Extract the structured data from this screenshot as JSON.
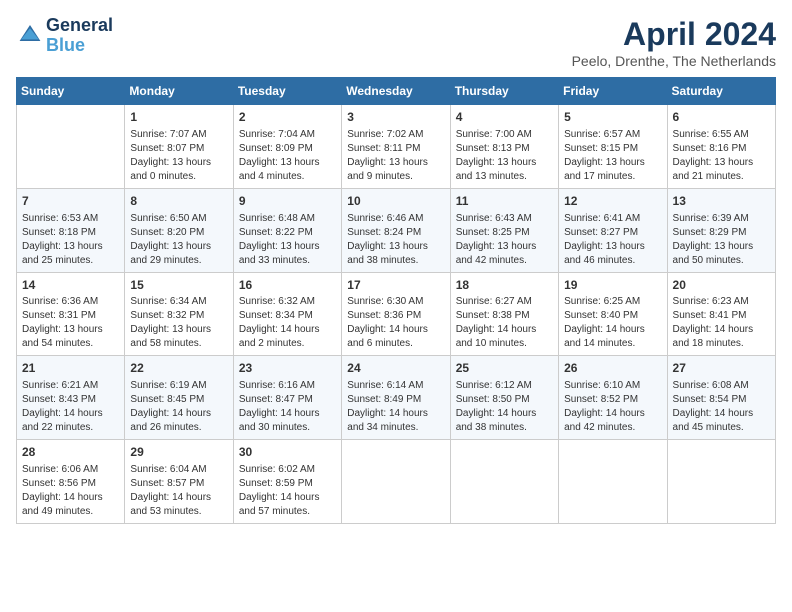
{
  "header": {
    "logo_line1": "General",
    "logo_line2": "Blue",
    "month_title": "April 2024",
    "location": "Peelo, Drenthe, The Netherlands"
  },
  "weekdays": [
    "Sunday",
    "Monday",
    "Tuesday",
    "Wednesday",
    "Thursday",
    "Friday",
    "Saturday"
  ],
  "weeks": [
    [
      {
        "day": "",
        "sunrise": "",
        "sunset": "",
        "daylight": ""
      },
      {
        "day": "1",
        "sunrise": "7:07 AM",
        "sunset": "8:07 PM",
        "daylight": "13 hours and 0 minutes."
      },
      {
        "day": "2",
        "sunrise": "7:04 AM",
        "sunset": "8:09 PM",
        "daylight": "13 hours and 4 minutes."
      },
      {
        "day": "3",
        "sunrise": "7:02 AM",
        "sunset": "8:11 PM",
        "daylight": "13 hours and 9 minutes."
      },
      {
        "day": "4",
        "sunrise": "7:00 AM",
        "sunset": "8:13 PM",
        "daylight": "13 hours and 13 minutes."
      },
      {
        "day": "5",
        "sunrise": "6:57 AM",
        "sunset": "8:15 PM",
        "daylight": "13 hours and 17 minutes."
      },
      {
        "day": "6",
        "sunrise": "6:55 AM",
        "sunset": "8:16 PM",
        "daylight": "13 hours and 21 minutes."
      }
    ],
    [
      {
        "day": "7",
        "sunrise": "6:53 AM",
        "sunset": "8:18 PM",
        "daylight": "13 hours and 25 minutes."
      },
      {
        "day": "8",
        "sunrise": "6:50 AM",
        "sunset": "8:20 PM",
        "daylight": "13 hours and 29 minutes."
      },
      {
        "day": "9",
        "sunrise": "6:48 AM",
        "sunset": "8:22 PM",
        "daylight": "13 hours and 33 minutes."
      },
      {
        "day": "10",
        "sunrise": "6:46 AM",
        "sunset": "8:24 PM",
        "daylight": "13 hours and 38 minutes."
      },
      {
        "day": "11",
        "sunrise": "6:43 AM",
        "sunset": "8:25 PM",
        "daylight": "13 hours and 42 minutes."
      },
      {
        "day": "12",
        "sunrise": "6:41 AM",
        "sunset": "8:27 PM",
        "daylight": "13 hours and 46 minutes."
      },
      {
        "day": "13",
        "sunrise": "6:39 AM",
        "sunset": "8:29 PM",
        "daylight": "13 hours and 50 minutes."
      }
    ],
    [
      {
        "day": "14",
        "sunrise": "6:36 AM",
        "sunset": "8:31 PM",
        "daylight": "13 hours and 54 minutes."
      },
      {
        "day": "15",
        "sunrise": "6:34 AM",
        "sunset": "8:32 PM",
        "daylight": "13 hours and 58 minutes."
      },
      {
        "day": "16",
        "sunrise": "6:32 AM",
        "sunset": "8:34 PM",
        "daylight": "14 hours and 2 minutes."
      },
      {
        "day": "17",
        "sunrise": "6:30 AM",
        "sunset": "8:36 PM",
        "daylight": "14 hours and 6 minutes."
      },
      {
        "day": "18",
        "sunrise": "6:27 AM",
        "sunset": "8:38 PM",
        "daylight": "14 hours and 10 minutes."
      },
      {
        "day": "19",
        "sunrise": "6:25 AM",
        "sunset": "8:40 PM",
        "daylight": "14 hours and 14 minutes."
      },
      {
        "day": "20",
        "sunrise": "6:23 AM",
        "sunset": "8:41 PM",
        "daylight": "14 hours and 18 minutes."
      }
    ],
    [
      {
        "day": "21",
        "sunrise": "6:21 AM",
        "sunset": "8:43 PM",
        "daylight": "14 hours and 22 minutes."
      },
      {
        "day": "22",
        "sunrise": "6:19 AM",
        "sunset": "8:45 PM",
        "daylight": "14 hours and 26 minutes."
      },
      {
        "day": "23",
        "sunrise": "6:16 AM",
        "sunset": "8:47 PM",
        "daylight": "14 hours and 30 minutes."
      },
      {
        "day": "24",
        "sunrise": "6:14 AM",
        "sunset": "8:49 PM",
        "daylight": "14 hours and 34 minutes."
      },
      {
        "day": "25",
        "sunrise": "6:12 AM",
        "sunset": "8:50 PM",
        "daylight": "14 hours and 38 minutes."
      },
      {
        "day": "26",
        "sunrise": "6:10 AM",
        "sunset": "8:52 PM",
        "daylight": "14 hours and 42 minutes."
      },
      {
        "day": "27",
        "sunrise": "6:08 AM",
        "sunset": "8:54 PM",
        "daylight": "14 hours and 45 minutes."
      }
    ],
    [
      {
        "day": "28",
        "sunrise": "6:06 AM",
        "sunset": "8:56 PM",
        "daylight": "14 hours and 49 minutes."
      },
      {
        "day": "29",
        "sunrise": "6:04 AM",
        "sunset": "8:57 PM",
        "daylight": "14 hours and 53 minutes."
      },
      {
        "day": "30",
        "sunrise": "6:02 AM",
        "sunset": "8:59 PM",
        "daylight": "14 hours and 57 minutes."
      },
      {
        "day": "",
        "sunrise": "",
        "sunset": "",
        "daylight": ""
      },
      {
        "day": "",
        "sunrise": "",
        "sunset": "",
        "daylight": ""
      },
      {
        "day": "",
        "sunrise": "",
        "sunset": "",
        "daylight": ""
      },
      {
        "day": "",
        "sunrise": "",
        "sunset": "",
        "daylight": ""
      }
    ]
  ],
  "labels": {
    "sunrise": "Sunrise:",
    "sunset": "Sunset:",
    "daylight": "Daylight:"
  }
}
